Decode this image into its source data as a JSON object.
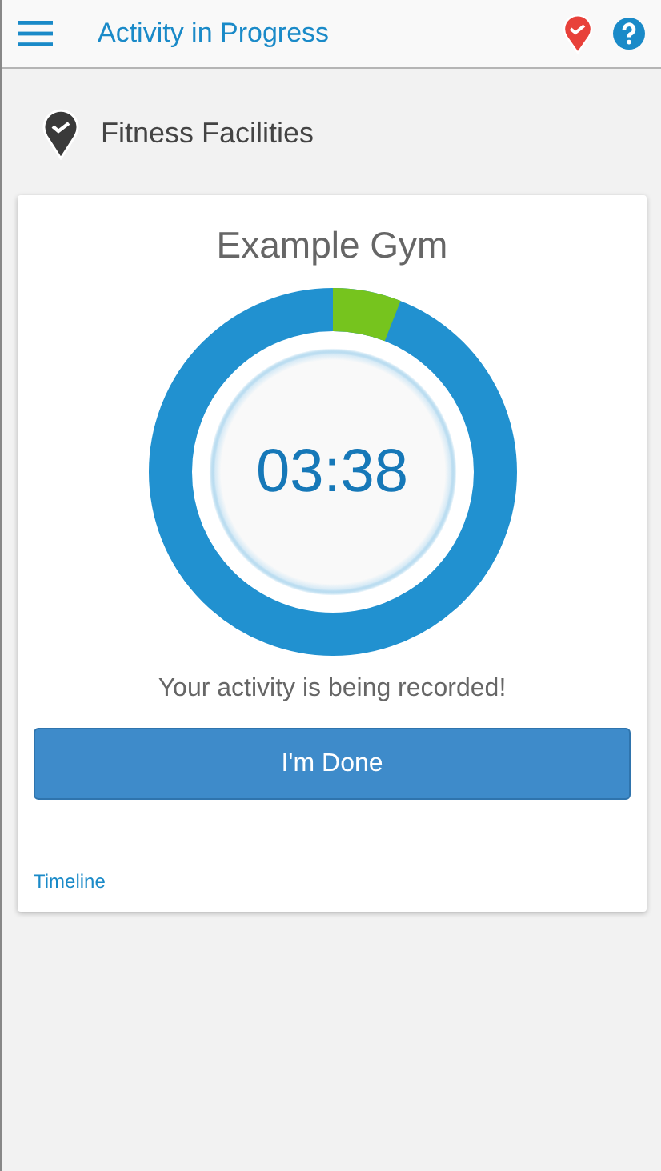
{
  "header": {
    "title": "Activity in Progress"
  },
  "section": {
    "title": "Fitness Facilities"
  },
  "card": {
    "title": "Example Gym",
    "timer": {
      "time": "03:38",
      "level": 0.06
    },
    "status": "Your activity is being recorded!",
    "button": "I'm Done",
    "link": "Timeline"
  }
}
